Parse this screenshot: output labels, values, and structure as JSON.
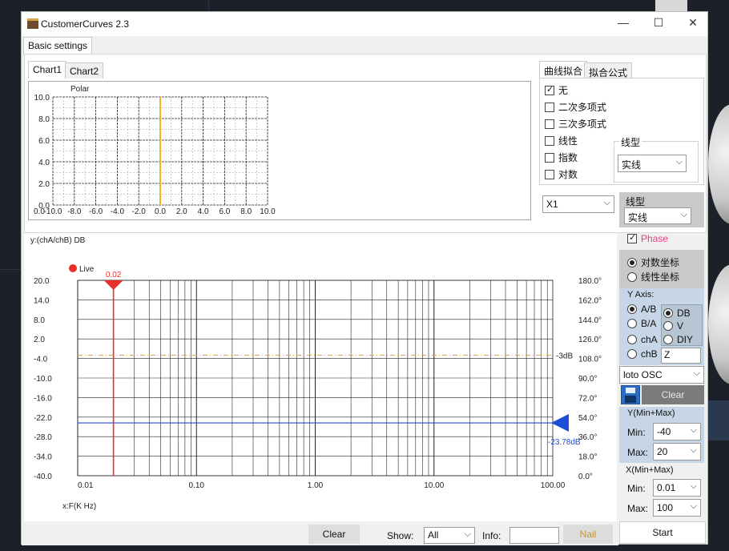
{
  "window": {
    "title": "CustomerCurves 2.3",
    "controls": {
      "minimize": "—",
      "maximize": "☐",
      "close": "✕"
    }
  },
  "top_tab": "Basic settings",
  "chart_tabs": [
    "Chart1",
    "Chart2"
  ],
  "fit_tabs": [
    "曲线拟合",
    "拟合公式"
  ],
  "fit_options": [
    {
      "label": "无",
      "checked": true
    },
    {
      "label": "二次多项式",
      "checked": false
    },
    {
      "label": "三次多项式",
      "checked": false
    },
    {
      "label": "线性",
      "checked": false
    },
    {
      "label": "指数",
      "checked": false
    },
    {
      "label": "对数",
      "checked": false
    }
  ],
  "line_style_group": {
    "legend": "线型",
    "value": "实线"
  },
  "channel_select": {
    "value": "X1"
  },
  "line_style_2": {
    "label": "线型",
    "value": "实线"
  },
  "phase": {
    "label": "Phase",
    "checked": true
  },
  "coord_options": [
    {
      "label": "对数坐标",
      "selected": true
    },
    {
      "label": "线性坐标",
      "selected": false
    }
  ],
  "y_axis": {
    "title": "Y Axis:",
    "sources": [
      {
        "label": "A/B",
        "selected": true
      },
      {
        "label": "B/A",
        "selected": false
      },
      {
        "label": "chA",
        "selected": false
      },
      {
        "label": "chB",
        "selected": false
      }
    ],
    "units": [
      {
        "label": "DB",
        "selected": true
      },
      {
        "label": "V",
        "selected": false
      },
      {
        "label": "DIY",
        "selected": false
      }
    ],
    "diy_value": "Z"
  },
  "device_select": {
    "value": "loto OSC"
  },
  "clear_label": "Clear",
  "y_range": {
    "title": "Y(Min+Max)",
    "min_label": "Min:",
    "min": "-40",
    "max_label": "Max:",
    "max": "20"
  },
  "x_range": {
    "title": "X(Min+Max)",
    "min_label": "Min:",
    "min": "0.01",
    "max_label": "Max:",
    "max": "100"
  },
  "start_label": "Start",
  "bottom_bar": {
    "clear_label": "Clear",
    "show_label": "Show:",
    "show_value": "All",
    "info_label": "Info:",
    "info_value": "",
    "nail_label": "Nail"
  },
  "colors": {
    "accent_red": "#e8302a",
    "accent_blue": "#1d4fd6",
    "marker_orange": "#f5b428",
    "phase_pink": "#e2408c",
    "minus3db_line": "#d9a445"
  },
  "chart_data": [
    {
      "type": "line",
      "title": "Polar",
      "x_ticks": [
        "0.0",
        "-10.0",
        "-8.0",
        "-6.0",
        "-4.0",
        "-2.0",
        "0.0",
        "2.0",
        "4.0",
        "6.0",
        "8.0",
        "10.0"
      ],
      "y_ticks": [
        "0.0",
        "2.0",
        "4.0",
        "6.0",
        "8.0",
        "10.0"
      ],
      "xlim": [
        -10,
        10
      ],
      "ylim": [
        0,
        10
      ],
      "series": [
        {
          "x": [
            0,
            0
          ],
          "y": [
            0,
            10
          ],
          "color": "#f5b428"
        }
      ]
    },
    {
      "type": "line",
      "ylabel": "y:(chA/chB) DB",
      "xlabel": "x:F(K Hz)",
      "x_scale": "log",
      "xlim": [
        0.01,
        100
      ],
      "ylim": [
        -40,
        20
      ],
      "x_ticks": [
        "0.01",
        "0.10",
        "1.00",
        "10.00",
        "100.00"
      ],
      "y_ticks": [
        "20.0",
        "14.0",
        "8.0",
        "2.0",
        "-4.0",
        "-10.0",
        "-16.0",
        "-22.0",
        "-28.0",
        "-34.0",
        "-40.0"
      ],
      "y2_ticks": [
        "180.0°",
        "162.0°",
        "144.0°",
        "126.0°",
        "108.0°",
        "90.0°",
        "72.0°",
        "54.0°",
        "36.0°",
        "18.0°",
        "0.0°"
      ],
      "legend": "Live",
      "cursor": {
        "x": 0.02,
        "label": "0.02"
      },
      "reference": {
        "y": -3,
        "label": "-3dB"
      },
      "series": [
        {
          "x": [
            0.01,
            100
          ],
          "y": [
            -23.78,
            -23.78
          ],
          "color": "#1d4fd6"
        }
      ],
      "value_marker": {
        "y": -23.78,
        "label": "-23.78dB"
      }
    }
  ]
}
